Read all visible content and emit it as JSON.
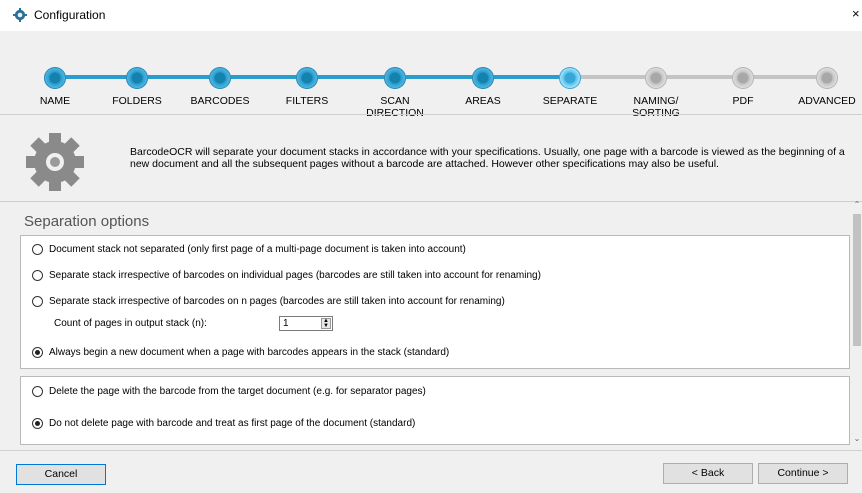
{
  "window": {
    "title": "Configuration",
    "close_glyph": "×",
    "icon": "gear-icon"
  },
  "steps": [
    {
      "label": "NAME",
      "state": "done"
    },
    {
      "label": "FOLDERS",
      "state": "done"
    },
    {
      "label": "BARCODES",
      "state": "done"
    },
    {
      "label": "FILTERS",
      "state": "done"
    },
    {
      "label": "SCAN\nDIRECTION",
      "state": "done"
    },
    {
      "label": "AREAS",
      "state": "done"
    },
    {
      "label": "SEPARATE",
      "state": "current"
    },
    {
      "label": "NAMING/\nSORTING",
      "state": "todo"
    },
    {
      "label": "PDF",
      "state": "todo"
    },
    {
      "label": "ADVANCED",
      "state": "todo"
    }
  ],
  "intro": {
    "icon": "gear-icon",
    "text": "BarcodeOCR will separate your document stacks in accordance with your specifications. Usually, one page with a barcode is viewed as the beginning of a new document and all the subsequent pages without a barcode are attached. However other specifications may also be useful."
  },
  "separation": {
    "title": "Separation options",
    "options": [
      {
        "label": "Document stack not separated (only first page of a multi-page document is taken into account)",
        "checked": false
      },
      {
        "label": "Separate stack irrespective of barcodes on individual pages (barcodes are still taken into account for renaming)",
        "checked": false
      },
      {
        "label": "Separate stack irrespective of barcodes on n pages (barcodes are still taken into account for renaming)",
        "checked": false
      },
      {
        "label": "Always begin a new document when a page with barcodes appears in the stack (standard)",
        "checked": true
      }
    ],
    "count_label": "Count of pages in output stack (n):",
    "count_value": "1"
  },
  "delete_options": [
    {
      "label": "Delete the page with the barcode from the target document (e.g. for separator pages)",
      "checked": false
    },
    {
      "label": "Do not delete page with barcode and treat as first page of the document (standard)",
      "checked": true
    }
  ],
  "footer": {
    "cancel": "Cancel",
    "back": "< Back",
    "continue": "Continue >"
  },
  "colors": {
    "step_done": "#2a9ccd",
    "step_current": "#5bc4ee",
    "step_todo": "#c4c4c4",
    "primary_border": "#0078d7"
  }
}
